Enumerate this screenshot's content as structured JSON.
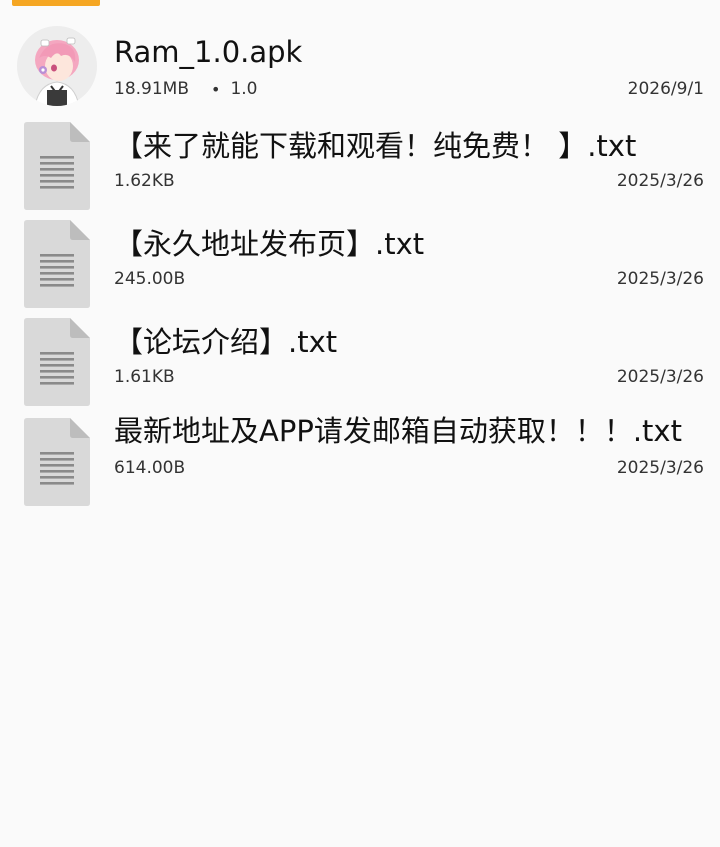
{
  "files": [
    {
      "name": "Ram_1.0.apk",
      "size": "18.91MB",
      "separator": "•",
      "version": "1.0",
      "date": "2026/9/1",
      "icon": "apk-avatar-icon"
    },
    {
      "name": "【来了就能下载和观看！纯免费！ 】.txt",
      "size": "1.62KB",
      "date": "2025/3/26",
      "icon": "text-file-icon"
    },
    {
      "name": "【永久地址发布页】.txt",
      "size": "245.00B",
      "date": "2025/3/26",
      "icon": "text-file-icon"
    },
    {
      "name": "【论坛介绍】.txt",
      "size": "1.61KB",
      "date": "2025/3/26",
      "icon": "text-file-icon"
    },
    {
      "name": "最新地址及APP请发邮箱自动获取！！！.txt",
      "size": "614.00B",
      "date": "2025/3/26",
      "icon": "text-file-icon"
    }
  ],
  "colors": {
    "accent": "#f5a623",
    "background": "#fafafa",
    "icon_gray": "#d9d9d9",
    "icon_lines": "#8a8a8a"
  }
}
